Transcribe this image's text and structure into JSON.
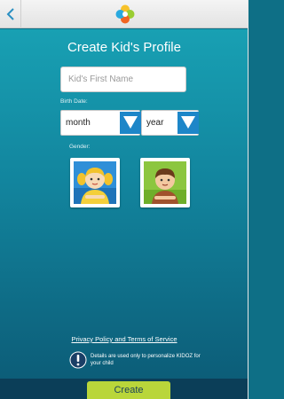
{
  "header": {
    "back_icon": "chevron-left-icon",
    "logo_icon": "kidoz-flower-logo"
  },
  "form": {
    "title": "Create Kid's Profile",
    "name_placeholder": "Kid's First Name",
    "birth_date_label": "Birth Date:",
    "month_value": "month",
    "year_value": "year",
    "gender_label": "Gender:"
  },
  "footer": {
    "privacy_link": "Privacy Policy and Terms of Service",
    "note": "Details are used only to personalize KIDOZ for your child",
    "create_label": "Create"
  },
  "colors": {
    "accent": "#1d86c8",
    "create_button": "#b9d63a",
    "background": "#12849d"
  }
}
